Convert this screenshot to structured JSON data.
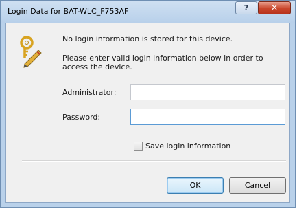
{
  "window": {
    "title": "Login Data for BAT-WLC_F753AF",
    "help_glyph": "?",
    "close_glyph": "✕"
  },
  "dialog": {
    "icon": "key-pencil-icon",
    "message_no_info": "No login information is stored for this device.",
    "message_prompt": "Please enter valid login information below in order to access the device.",
    "administrator_label": "Administrator:",
    "administrator_value": "",
    "password_label": "Password:",
    "password_value": "",
    "save_checkbox_label": "Save login information",
    "save_checked": false,
    "ok_label": "OK",
    "cancel_label": "Cancel"
  },
  "colors": {
    "title_bar": "#b9d1ea",
    "close_button": "#c9462b",
    "focus_border": "#5b9bd5"
  }
}
